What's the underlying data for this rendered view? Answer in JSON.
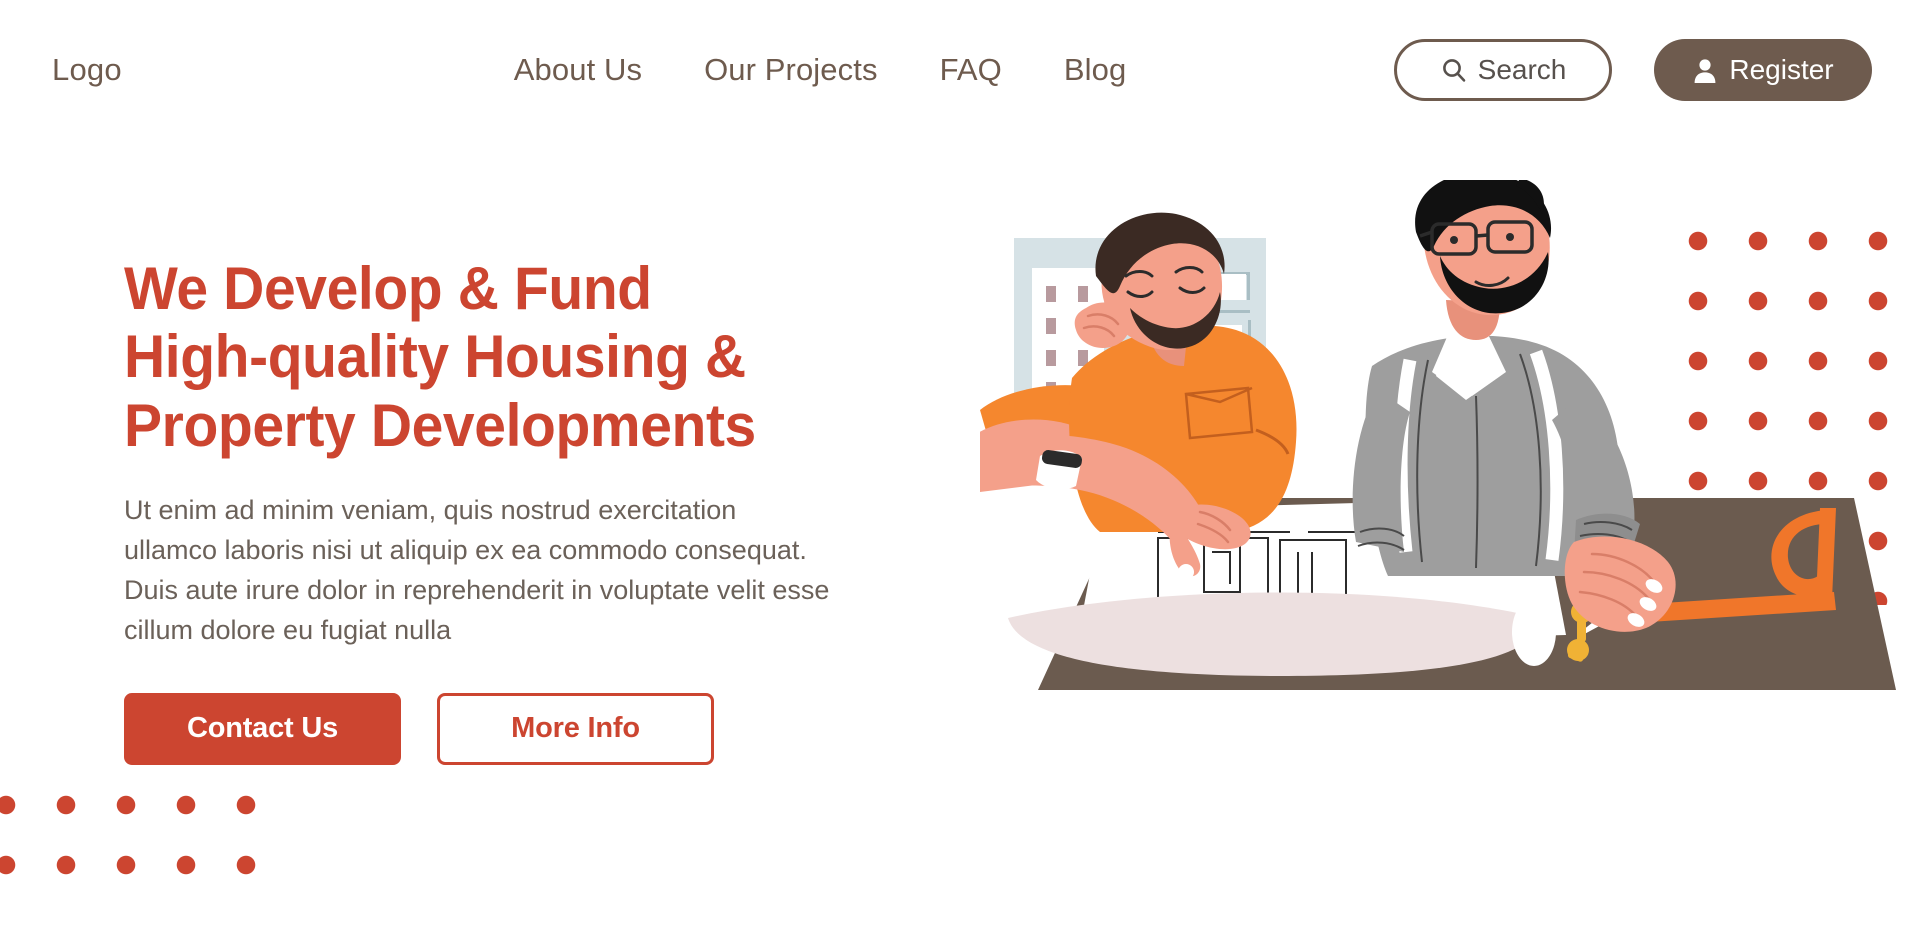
{
  "header": {
    "logo": "Logo",
    "nav": [
      {
        "label": "About Us"
      },
      {
        "label": "Our Projects"
      },
      {
        "label": "FAQ"
      },
      {
        "label": "Blog"
      }
    ],
    "search": {
      "label": "Search",
      "icon": "search-icon"
    },
    "register": {
      "label": "Register",
      "icon": "person-icon"
    }
  },
  "hero": {
    "title": "We Develop & Fund High-quality Housing & Property Developments",
    "title_lines": [
      "We Develop & Fund",
      "High-quality Housing &",
      "Property Developments"
    ],
    "subtitle": "Ut enim ad minim veniam, quis nostrud exercitation ullamco laboris nisi ut aliquip ex ea commodo consequat. Duis aute irure dolor in reprehenderit in voluptate velit esse cillum dolore eu fugiat nulla",
    "primary_cta": "Contact Us",
    "secondary_cta": "More Info"
  },
  "illustration": {
    "alt": "Two architects reviewing building blueprints at a drafting desk",
    "elements": [
      "background-building-panel",
      "architect-orange-shirt",
      "architect-gray-sweater",
      "drafting-desk",
      "blueprint-roll",
      "floor-plan-drawing",
      "drafting-compass",
      "protractor",
      "ruler"
    ]
  },
  "decor": {
    "dots_top_right": "red-dot-grid",
    "dots_bottom_left": "red-dot-grid"
  },
  "colors": {
    "accent_red": "#CC4530",
    "brown": "#6E5B4E",
    "text_body": "#6b6159",
    "panel_blue": "#D6E2E6",
    "orange": "#F5872E",
    "skin": "#F4A08A",
    "gray_sweater": "#9E9E9E",
    "desk_brown": "#6B5B4F",
    "background": "#FFFFFF"
  }
}
